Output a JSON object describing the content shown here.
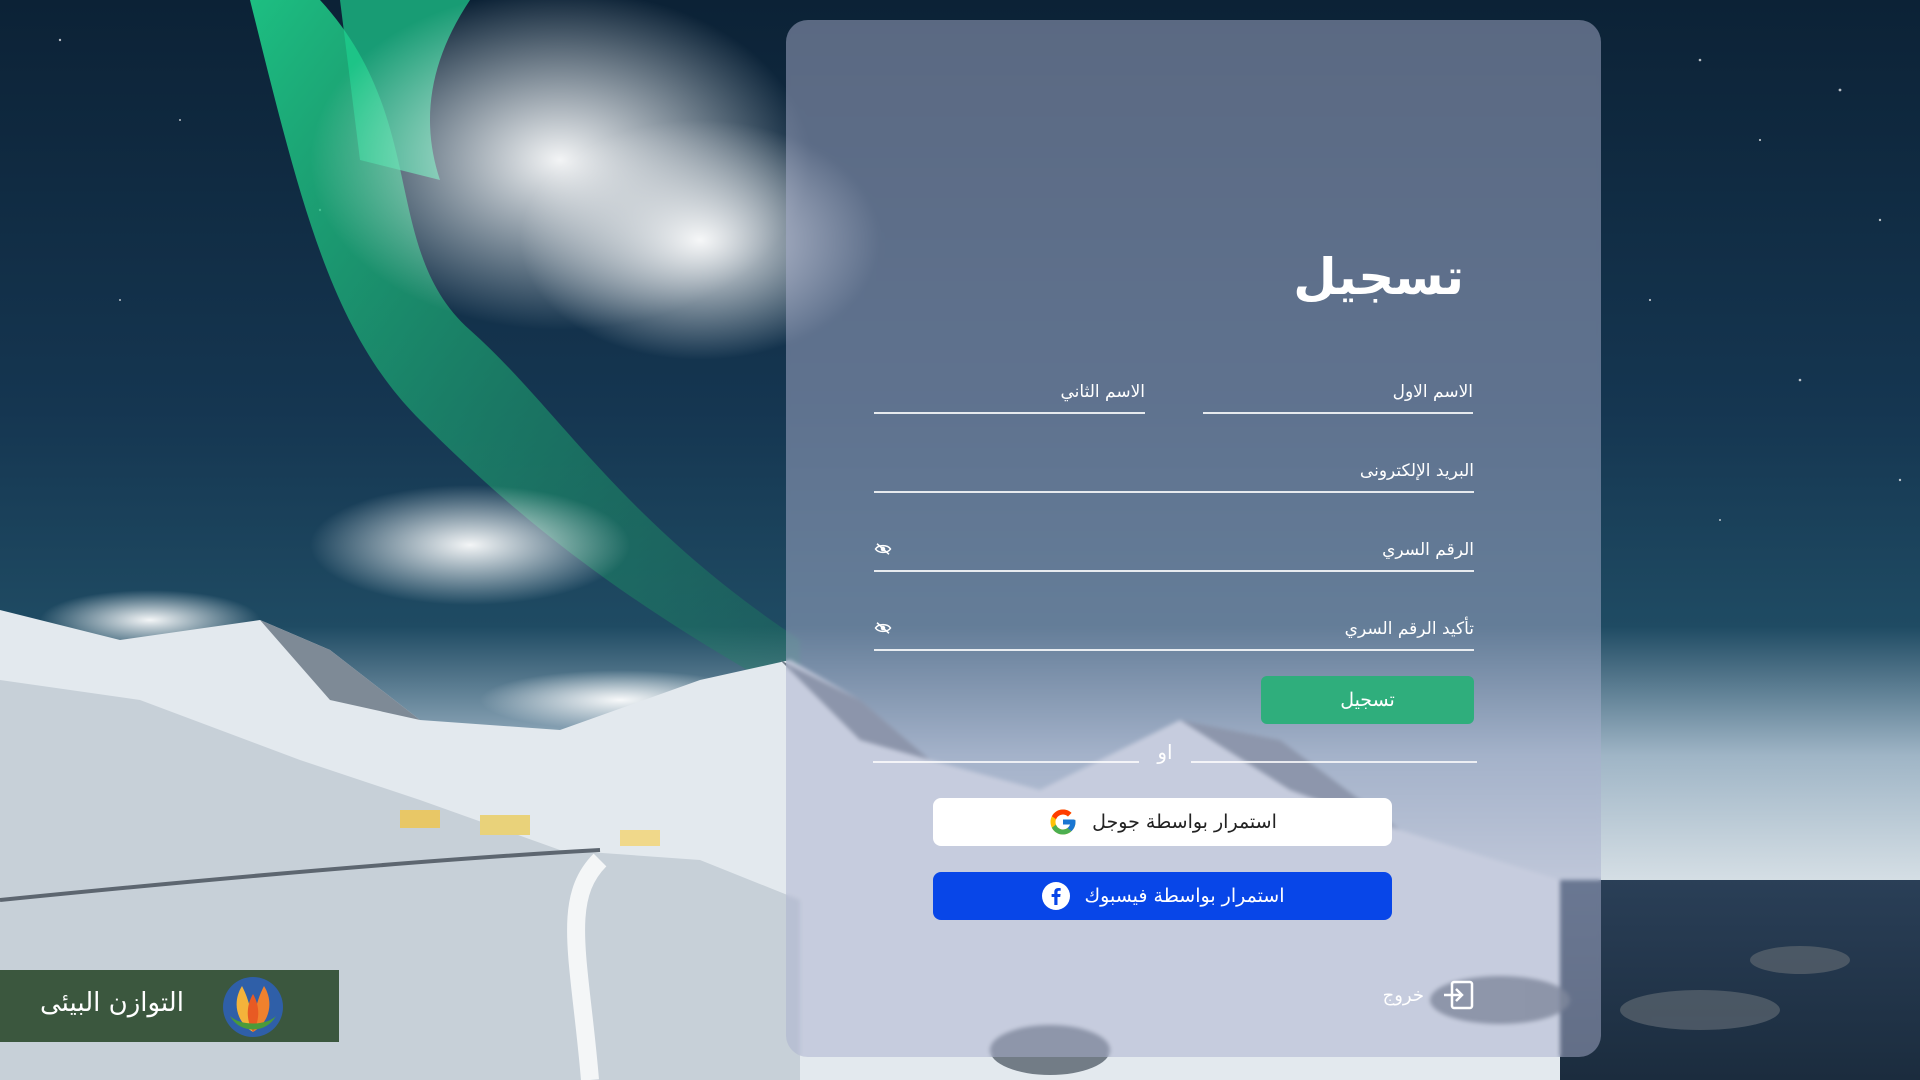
{
  "brand": {
    "name": "التوازن البيئى",
    "bar_color": "#2c472a"
  },
  "form": {
    "title": "تسجيل",
    "fields": {
      "first_name": "الاسم الاول",
      "last_name": "الاسم الثاني",
      "email": "البريد الإلكترونى",
      "password": "الرقم السري",
      "confirm_password": "تأكيد الرقم السري"
    },
    "submit_label": "تسجيل",
    "or_label": "او",
    "google_label": "استمرار بواسطة جوجل",
    "facebook_label": "استمرار بواسطة فيسبوك",
    "exit_label": "خروج"
  },
  "colors": {
    "accent_green": "#2fae7c",
    "facebook_blue": "#0846e8",
    "card_overlay": "rgba(170,175,205,0.5)"
  },
  "icons": {
    "password_toggle": "eye-slash-icon",
    "google": "google-icon",
    "facebook": "facebook-icon",
    "exit": "logout-icon",
    "brand": "leaf-logo-icon"
  }
}
